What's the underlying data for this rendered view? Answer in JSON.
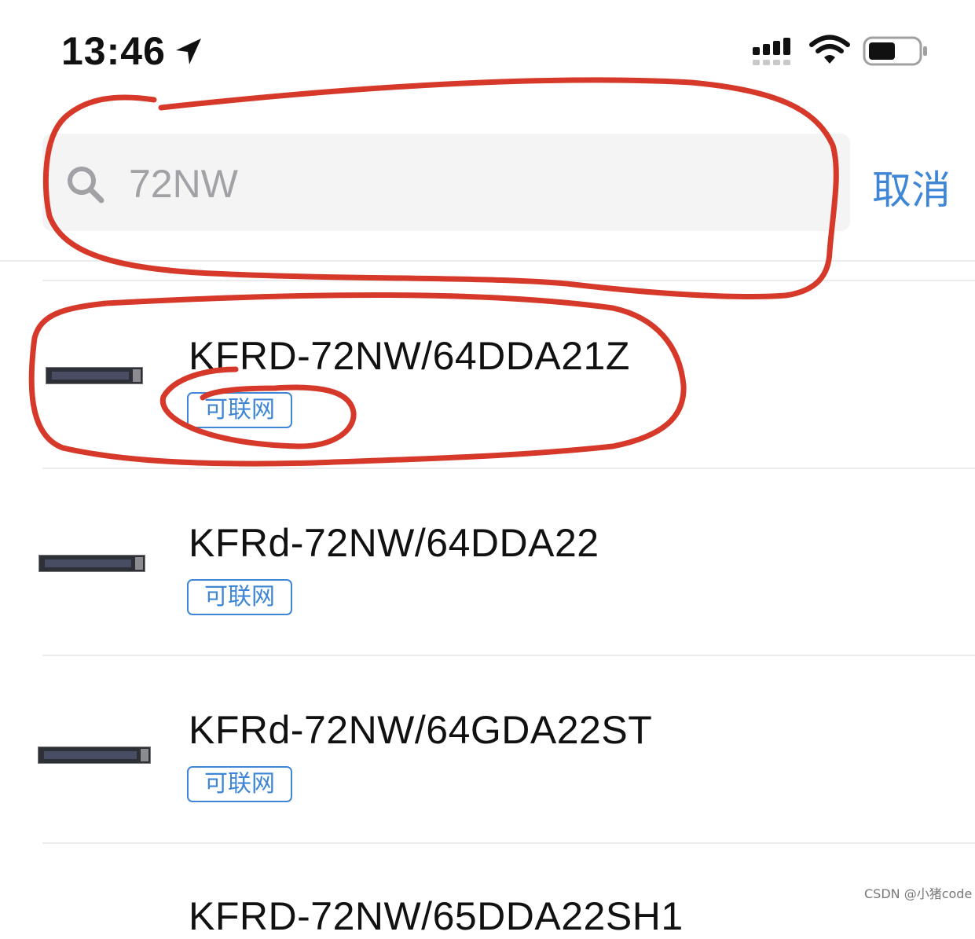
{
  "status_bar": {
    "time": "13:46",
    "icons": [
      "location-arrow-icon",
      "cellular-signal-icon",
      "wifi-icon",
      "battery-icon"
    ]
  },
  "search": {
    "value": "72NW",
    "placeholder": "",
    "icon": "search-icon",
    "cancel_label": "取消"
  },
  "results": [
    {
      "model": "KFRD-72NW/64DDA21Z",
      "badge": "可联网"
    },
    {
      "model": "KFRd-72NW/64DDA22",
      "badge": "可联网"
    },
    {
      "model": "KFRd-72NW/64GDA22ST",
      "badge": "可联网"
    },
    {
      "model": "KFRD-72NW/65DDA22SH1",
      "badge": ""
    }
  ],
  "watermark": "CSDN @小猪code",
  "colors": {
    "accent": "#3f87d6",
    "search_bg": "#f4f4f5",
    "annotation_red": "#d6392a",
    "divider": "#ececee"
  }
}
